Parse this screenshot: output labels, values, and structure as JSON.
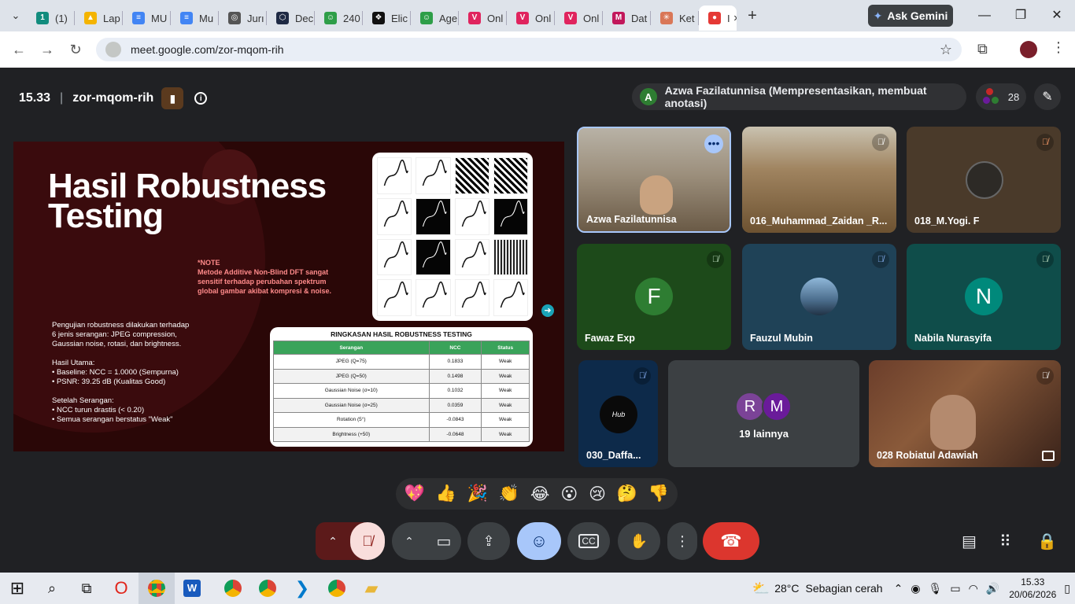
{
  "browser": {
    "tabs": [
      {
        "label": "(1)",
        "color": "#128C7E",
        "glyph": "1"
      },
      {
        "label": "Lap",
        "color": "#f4b400",
        "glyph": "▲"
      },
      {
        "label": "MU",
        "color": "#4285f4",
        "glyph": "≡"
      },
      {
        "label": "Mu",
        "color": "#4285f4",
        "glyph": "≡"
      },
      {
        "label": "Jurı",
        "color": "#555555",
        "glyph": "◎"
      },
      {
        "label": "Dec",
        "color": "#1f2a44",
        "glyph": "⬡"
      },
      {
        "label": "240",
        "color": "#2e9e48",
        "glyph": "☺"
      },
      {
        "label": "Elic",
        "color": "#111111",
        "glyph": "❖"
      },
      {
        "label": "Age",
        "color": "#2e9e48",
        "glyph": "☺"
      },
      {
        "label": "Onl",
        "color": "#e0245e",
        "glyph": "V"
      },
      {
        "label": "Onl",
        "color": "#e0245e",
        "glyph": "V"
      },
      {
        "label": "Onl",
        "color": "#e0245e",
        "glyph": "V"
      },
      {
        "label": "Dat",
        "color": "#c2185b",
        "glyph": "M"
      },
      {
        "label": "Ket",
        "color": "#d97757",
        "glyph": "✳"
      },
      {
        "label": "I",
        "color": "#e53935",
        "glyph": "●",
        "active": true
      }
    ],
    "gemini_label": "Ask Gemini",
    "url": "meet.google.com/zor-mqom-rih"
  },
  "meet": {
    "time": "15.33",
    "meeting_code": "zor-mqom-rih",
    "presenter_initial": "A",
    "presenter_label": "Azwa Fazilatunnisa (Mempresentasikan, membuat anotasi)",
    "participant_count": "28",
    "tiles": [
      {
        "name": "Azwa Fazilatunnisa"
      },
      {
        "name": "016_Muhammad_Zaidan _R..."
      },
      {
        "name": "018_M.Yogi. F"
      },
      {
        "name": "Fawaz Exp",
        "initial": "F",
        "color": "#2e7d32"
      },
      {
        "name": "Fauzul Mubin"
      },
      {
        "name": "Nabila Nurasyifa",
        "initial": "N",
        "color": "#00897b"
      },
      {
        "name": "030_Daffa..."
      },
      {
        "name": "19 lainnya",
        "initials": [
          "R",
          "M"
        ]
      },
      {
        "name": "028 Robiatul Adawiah"
      }
    ],
    "reactions": [
      "💖",
      "👍",
      "🎉",
      "👏",
      "😂",
      "😮",
      "😢",
      "🤔",
      "👎"
    ]
  },
  "slide": {
    "title_line1": "Hasil Robustness",
    "title_line2": "Testing",
    "note_head": "*NOTE",
    "note_body": "Metode Additive Non-Blind DFT sangat sensitif terhadap perubahan spektrum global gambar akibat kompresi & noise.",
    "body": [
      "Pengujian robustness dilakukan terhadap",
      "6 jenis serangan: JPEG compression,",
      "Gaussian noise, rotasi, dan brightness.",
      "",
      "Hasil Utama:",
      "• Baseline: NCC = 1.0000 (Sempurna)",
      "• PSNR: 39.25 dB (Kualitas Good)",
      "",
      "Setelah Serangan:",
      "• NCC turun drastis (< 0.20)",
      "• Semua serangan berstatus \"Weak\""
    ],
    "table_title": "RINGKASAN HASIL ROBUSTNESS TESTING",
    "table_headers": [
      "Serangan",
      "NCC",
      "Status"
    ],
    "table_rows": [
      [
        "JPEG (Q=75)",
        "0.1833",
        "Weak"
      ],
      [
        "JPEG (Q=50)",
        "0.1498",
        "Weak"
      ],
      [
        "Gaussian Noise (σ=10)",
        "0.1032",
        "Weak"
      ],
      [
        "Gaussian Noise (σ=25)",
        "0.0359",
        "Weak"
      ],
      [
        "Rotation (5°)",
        "-0.0843",
        "Weak"
      ],
      [
        "Brightness (+50)",
        "-0.0648",
        "Weak"
      ]
    ]
  },
  "taskbar": {
    "weather_temp": "28°C",
    "weather_desc": "Sebagian cerah",
    "clock_time": "15.33",
    "clock_date": "20/06/2026"
  }
}
